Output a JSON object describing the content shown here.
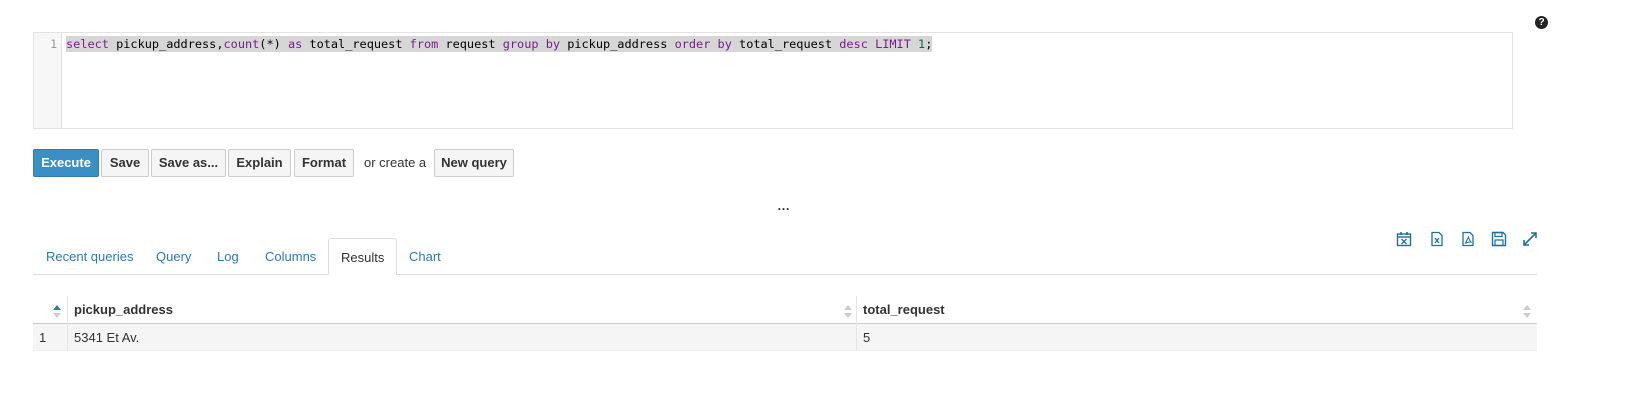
{
  "help": {
    "glyph": "?"
  },
  "editor": {
    "line_number": "1",
    "tokens": [
      {
        "t": "select",
        "c": "kw"
      },
      {
        "t": " pickup_address,",
        "c": ""
      },
      {
        "t": "count",
        "c": "fn"
      },
      {
        "t": "(*) ",
        "c": ""
      },
      {
        "t": "as",
        "c": "kw"
      },
      {
        "t": " total_request ",
        "c": ""
      },
      {
        "t": "from",
        "c": "kw"
      },
      {
        "t": " request ",
        "c": ""
      },
      {
        "t": "group",
        "c": "kw"
      },
      {
        "t": " ",
        "c": ""
      },
      {
        "t": "by",
        "c": "kw"
      },
      {
        "t": " pickup_address ",
        "c": ""
      },
      {
        "t": "order",
        "c": "kw"
      },
      {
        "t": " ",
        "c": ""
      },
      {
        "t": "by",
        "c": "kw"
      },
      {
        "t": " total_request ",
        "c": ""
      },
      {
        "t": "desc",
        "c": "kw"
      },
      {
        "t": " ",
        "c": ""
      },
      {
        "t": "LIMIT",
        "c": "kw"
      },
      {
        "t": " ",
        "c": ""
      },
      {
        "t": "1",
        "c": "num"
      },
      {
        "t": ";",
        "c": ""
      }
    ]
  },
  "toolbar": {
    "execute_label": "Execute",
    "save_label": "Save",
    "save_as_label": "Save as...",
    "explain_label": "Explain",
    "format_label": "Format",
    "or_create_text": "or create a",
    "new_query_label": "New query"
  },
  "splitter": {
    "glyph": "…"
  },
  "actions": [
    "calendar-export-icon",
    "excel-export-icon",
    "pdf-export-icon",
    "save-icon",
    "expand-icon"
  ],
  "tabs": {
    "recent_queries": "Recent queries",
    "query": "Query",
    "log": "Log",
    "columns": "Columns",
    "results": "Results",
    "chart": "Chart",
    "active": "Results"
  },
  "results": {
    "columns": [
      "pickup_address",
      "total_request"
    ],
    "rows": [
      {
        "index": "1",
        "pickup_address": "5341 Et Av.",
        "total_request": "5"
      }
    ]
  },
  "colors": {
    "accent": "#3a8fc4",
    "link": "#2a7ab5",
    "keyword": "#7a1d8c"
  }
}
